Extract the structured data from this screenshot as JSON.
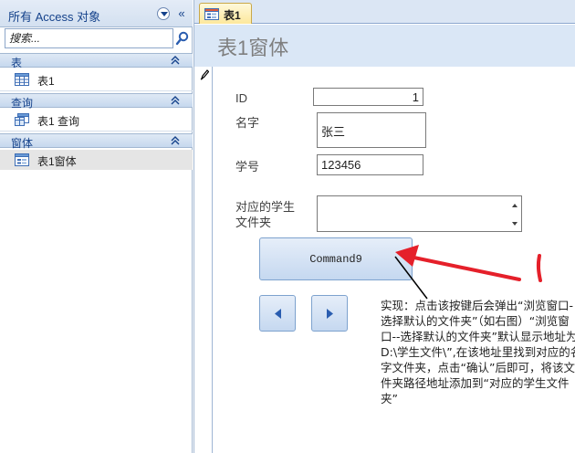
{
  "nav": {
    "title": "所有 Access 对象",
    "collapse_glyph": "«",
    "search": {
      "placeholder": "搜索...",
      "value": ""
    },
    "groups": [
      {
        "title": "表",
        "items": [
          {
            "label": "表1",
            "icon": "table-icon"
          }
        ]
      },
      {
        "title": "查询",
        "items": [
          {
            "label": "表1 查询",
            "icon": "query-icon"
          }
        ]
      },
      {
        "title": "窗体",
        "items": [
          {
            "label": "表1窗体",
            "icon": "form-icon"
          }
        ]
      }
    ]
  },
  "document": {
    "tab_label": "表1",
    "form_title": "表1窗体"
  },
  "form": {
    "id_label": "ID",
    "id_value": "1",
    "name_label": "名字",
    "name_value": "张三",
    "student_no_label": "学号",
    "student_no_value": "123456",
    "folder_label_line1": "对应的学生",
    "folder_label_line2": "文件夹",
    "folder_value": "",
    "command_label": "Command9"
  },
  "annotation": {
    "text": "实现：点击该按键后会弹出“浏览窗口-选择默认的文件夹”（如右图）“浏览窗口--选择默认的文件夹”默认显示地址为D:\\学生文件\\”,在该地址里找到对应的名字文件夹，点击“确认”后即可，将该文件夹路径地址添加到“对应的学生文件夹”"
  },
  "colors": {
    "accent_blue": "#15428b",
    "form_header_bg": "#dae7f6",
    "tab_active_bg": "#fde89c",
    "annotation_arrow": "#e5202a"
  }
}
